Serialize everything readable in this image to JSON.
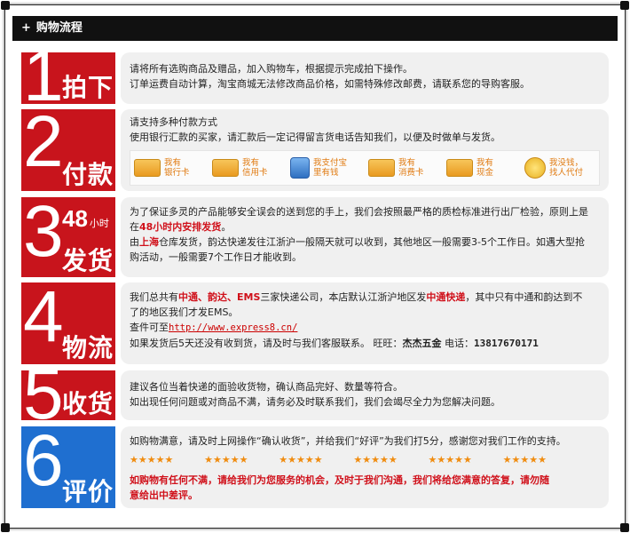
{
  "header": {
    "title": "购物流程"
  },
  "steps": {
    "s1": {
      "num": "1",
      "word": "拍下",
      "lines": [
        "请将所有选购商品及赠品，加入购物车，根据提示完成拍下操作。",
        "订单运费自动计算，淘宝商城无法修改商品价格，如需特殊修改邮费，请联系您的导购客服。"
      ]
    },
    "s2": {
      "num": "2",
      "word": "付款",
      "lines": [
        "请支持多种付款方式",
        "使用银行汇款的买家，请汇款后一定记得留言货电话告知我们，以便及时做单与发货。"
      ],
      "pays": [
        {
          "l1": "我有",
          "l2": "银行卡"
        },
        {
          "l1": "我有",
          "l2": "信用卡"
        },
        {
          "l1": "我支付宝",
          "l2": "里有钱"
        },
        {
          "l1": "我有",
          "l2": "消费卡"
        },
        {
          "l1": "我有",
          "l2": "现金"
        },
        {
          "l1": "我没钱，",
          "l2": "找人代付"
        }
      ]
    },
    "s3": {
      "num": "3",
      "big": "48",
      "hour": "小时",
      "word": "发货",
      "l1": "为了保证多灵的产品能够安全误会的送到您的手上，我们会按照最严格的质检标准进行出厂检验，原则上是",
      "l2a": "在",
      "l2b": "48小时内安排发货",
      "l2c": "。",
      "l3a": "由",
      "l3b": "上海",
      "l3c": "仓库发货，韵达快递发往江浙沪一般隔天就可以收到，其他地区一般需要3-5个工作日。如遇大型抢",
      "l4": "购活动，一般需要7个工作日才能收到。"
    },
    "s4": {
      "num": "4",
      "word": "物流",
      "l1a": "我们总共有",
      "l1b": "中通、韵达、EMS",
      "l1c": "三家快递公司，本店默认江浙沪地区发",
      "l1d": "中通快递",
      "l1e": "，其中只有中通和韵达到不",
      "l2": "了的地区我们才发EMS。",
      "l3a": "查件可至",
      "l3b": "http://www.express8.cn/",
      "l4a": "如果发货后5天还没有收到货，请及时与我们客服联系。 旺旺：",
      "l4b": "杰杰五金",
      "l4c": "  电话：",
      "l4d": "13817670171"
    },
    "s5": {
      "num": "5",
      "word": "收货",
      "lines": [
        "建议各位当着快递的面验收货物，确认商品完好、数量等符合。",
        "如出现任何问题或对商品不满，请务必及时联系我们，我们会竭尽全力为您解决问题。"
      ]
    },
    "s6": {
      "num": "6",
      "word": "评价",
      "l1": "如购物满意，请及时上网操作“确认收货”，并给我们“好评”为我们打5分，感谢您对我们工作的支持。",
      "stars": [
        "★★★★★",
        "★★★★★",
        "★★★★★",
        "★★★★★",
        "★★★★★",
        "★★★★★"
      ],
      "l2": "如购物有任何不满，请给我们为您服务的机会，及时于我们沟通，我们将给您满意的答复，请勿随",
      "l3": "意给出中差评。"
    }
  },
  "colors": {
    "red": "#c8141c",
    "blue": "#1f6fd0",
    "header": "#111111"
  }
}
